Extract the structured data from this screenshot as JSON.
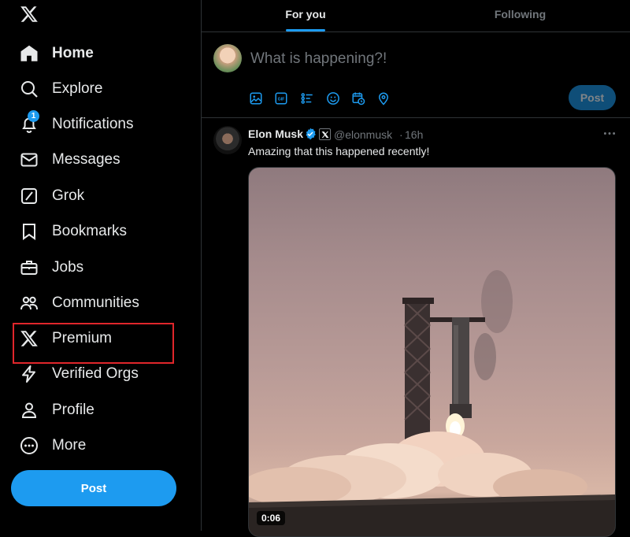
{
  "sidebar": {
    "logo": "x-logo-icon",
    "items": [
      {
        "label": "Home",
        "icon": "home-icon",
        "active": true
      },
      {
        "label": "Explore",
        "icon": "search-icon"
      },
      {
        "label": "Notifications",
        "icon": "bell-icon",
        "badge": "1"
      },
      {
        "label": "Messages",
        "icon": "envelope-icon"
      },
      {
        "label": "Grok",
        "icon": "grok-icon"
      },
      {
        "label": "Bookmarks",
        "icon": "bookmark-icon"
      },
      {
        "label": "Jobs",
        "icon": "briefcase-icon"
      },
      {
        "label": "Communities",
        "icon": "people-icon"
      },
      {
        "label": "Premium",
        "icon": "x-logo-icon"
      },
      {
        "label": "Verified Orgs",
        "icon": "lightning-icon"
      },
      {
        "label": "Profile",
        "icon": "person-icon"
      },
      {
        "label": "More",
        "icon": "more-circle-icon"
      }
    ],
    "post_label": "Post",
    "highlight_color": "#e0262b"
  },
  "tabs": [
    {
      "label": "For you",
      "active": true
    },
    {
      "label": "Following",
      "active": false
    }
  ],
  "composer": {
    "placeholder": "What is happening?!",
    "tools": [
      "image-icon",
      "gif-icon",
      "poll-icon",
      "emoji-icon",
      "schedule-icon",
      "location-icon"
    ],
    "gif_text": "GIF",
    "post_label": "Post"
  },
  "tweet": {
    "author": "Elon Musk",
    "handle": "@elonmusk",
    "separator": "·",
    "time": "16h",
    "text": "Amazing that this happened recently!",
    "media_duration": "0:06"
  },
  "colors": {
    "accent": "#1d9bf0",
    "background": "#000000",
    "text": "#e7e9ea",
    "muted": "#71767b",
    "border": "#2f3336"
  }
}
